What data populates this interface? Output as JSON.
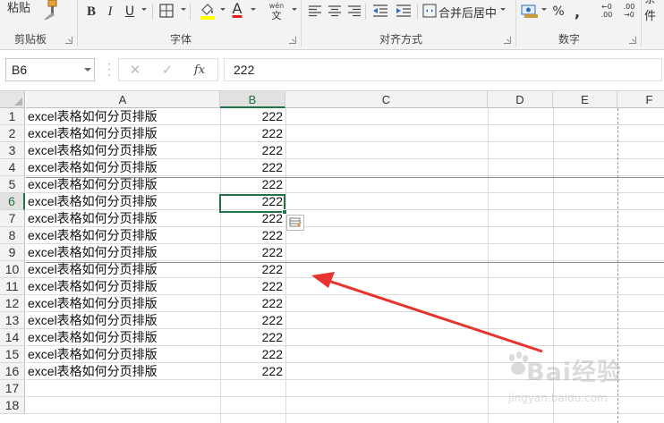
{
  "ribbon": {
    "paste_label": "粘贴",
    "clipboard_label": "剪贴板",
    "font_label": "字体",
    "bold_label": "B",
    "italic_label": "I",
    "underline_label": "U",
    "font_color_label": "A",
    "phonetic_label": "wén",
    "phonetic_char": "文",
    "alignment_label": "对齐方式",
    "merge_center_label": "合并后居中",
    "number_label": "数字",
    "percent_label": "%",
    "comma_label": ",",
    "increase_decimal_top": "←0",
    "increase_decimal_bottom": ".00",
    "decrease_decimal_top": ".00",
    "decrease_decimal_bottom": "→0",
    "conditional_label": "条件",
    "accent_color": "#217346",
    "highlight_color": "#ffff00",
    "font_color": "#e3211c"
  },
  "formula_bar": {
    "name_box": "B6",
    "cancel": "✕",
    "enter": "✓",
    "fx": "fx",
    "value": "222"
  },
  "grid": {
    "columns": [
      "A",
      "B",
      "C",
      "D",
      "E",
      "F"
    ],
    "rows": [
      "1",
      "2",
      "3",
      "4",
      "5",
      "6",
      "7",
      "8",
      "9",
      "10",
      "11",
      "12",
      "13",
      "14",
      "15",
      "16",
      "17",
      "18"
    ],
    "cells": [
      {
        "a": "excel表格如何分页排版",
        "b": "222"
      },
      {
        "a": "excel表格如何分页排版",
        "b": "222"
      },
      {
        "a": "excel表格如何分页排版",
        "b": "222"
      },
      {
        "a": "excel表格如何分页排版",
        "b": "222"
      },
      {
        "a": "excel表格如何分页排版",
        "b": "222"
      },
      {
        "a": "excel表格如何分页排版",
        "b": "222"
      },
      {
        "a": "excel表格如何分页排版",
        "b": "222"
      },
      {
        "a": "excel表格如何分页排版",
        "b": "222"
      },
      {
        "a": "excel表格如何分页排版",
        "b": "222"
      },
      {
        "a": "excel表格如何分页排版",
        "b": "222"
      },
      {
        "a": "excel表格如何分页排版",
        "b": "222"
      },
      {
        "a": "excel表格如何分页排版",
        "b": "222"
      },
      {
        "a": "excel表格如何分页排版",
        "b": "222"
      },
      {
        "a": "excel表格如何分页排版",
        "b": "222"
      },
      {
        "a": "excel表格如何分页排版",
        "b": "222"
      },
      {
        "a": "excel表格如何分页排版",
        "b": "222"
      }
    ],
    "selected_column": "B",
    "selected_row": "6",
    "annotation_arrow_color": "#e8342e"
  },
  "watermark": {
    "text": "Bai经验",
    "sub": "jingyan.baidu.com"
  }
}
